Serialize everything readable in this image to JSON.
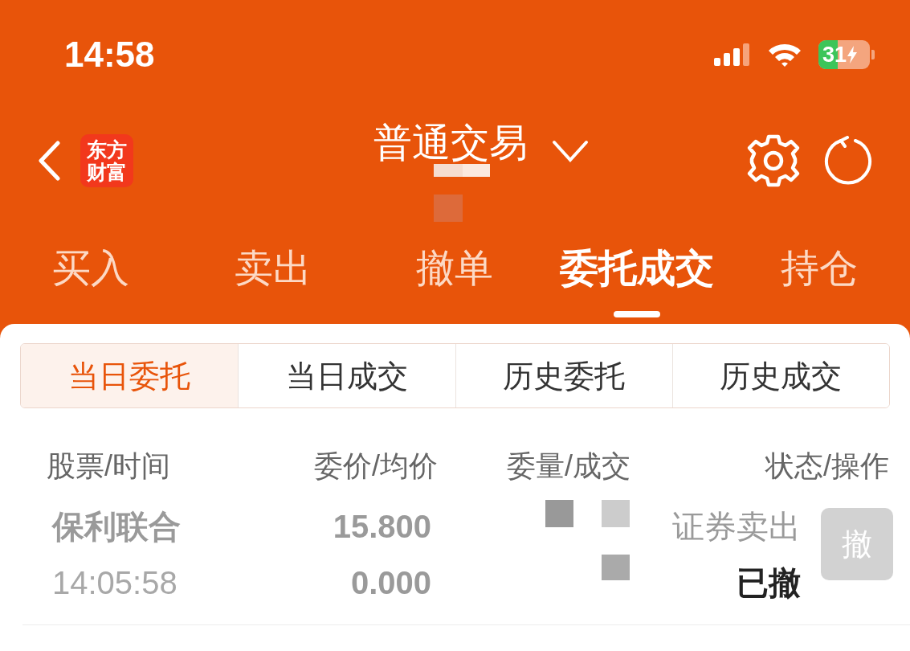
{
  "status_bar": {
    "time": "14:58",
    "battery": "31"
  },
  "nav": {
    "logo_lines": [
      "东方",
      "财富"
    ],
    "title": "普通交易"
  },
  "tabs": [
    {
      "label": "买入",
      "selected": false
    },
    {
      "label": "卖出",
      "selected": false
    },
    {
      "label": "撤单",
      "selected": false
    },
    {
      "label": "委托成交",
      "selected": true
    },
    {
      "label": "持仓",
      "selected": false
    }
  ],
  "segments": [
    {
      "label": "当日委托",
      "selected": true
    },
    {
      "label": "当日成交",
      "selected": false
    },
    {
      "label": "历史委托",
      "selected": false
    },
    {
      "label": "历史成交",
      "selected": false
    }
  ],
  "table": {
    "columns": [
      "股票/时间",
      "委价/均价",
      "委量/成交",
      "状态/操作"
    ],
    "rows": [
      {
        "stock": "保利联合",
        "time": "14:05:58",
        "order_price": "15.800",
        "avg_price": "0.000",
        "type": "证券卖出",
        "status": "已撤",
        "action": {
          "label": "撤",
          "disabled": true
        }
      }
    ]
  }
}
